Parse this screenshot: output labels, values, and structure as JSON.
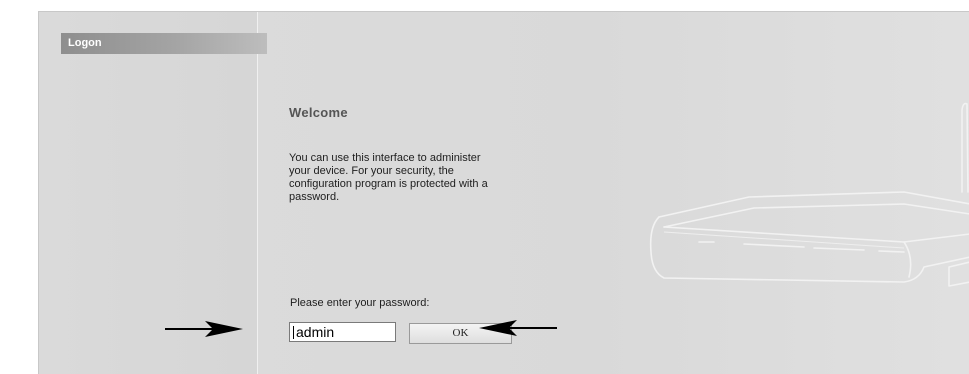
{
  "sidebar": {
    "header_label": "Logon"
  },
  "main": {
    "welcome_title": "Welcome",
    "description_lines": [
      "You can use this interface to administer",
      "your device. For your security, the",
      "configuration program is protected with a",
      "password."
    ],
    "password_prompt": "Please enter your password:",
    "password_value": "admin",
    "ok_label": "OK"
  },
  "icons": [
    "router-illustration",
    "arrow-right-icon",
    "arrow-left-icon"
  ],
  "colors": {
    "logon_bar": "#8e8e8e",
    "background": "#dcdcdc",
    "text": "#1e1e1e",
    "title": "#555555"
  }
}
